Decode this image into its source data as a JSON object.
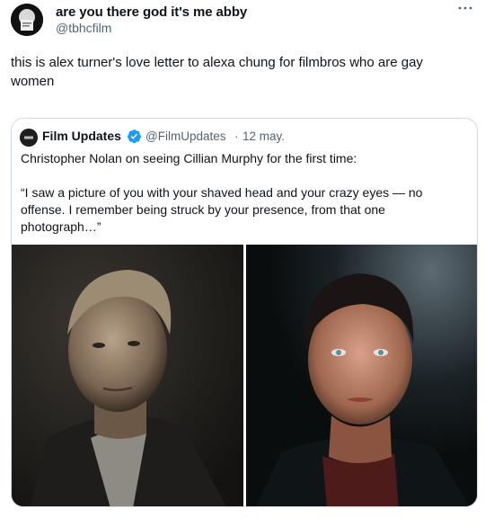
{
  "author": {
    "name": "are you there god it's me abby",
    "handle": "@tbhcfilm",
    "avatar_icon": "profile-photo"
  },
  "more_icon": "more-horizontal-icon",
  "tweet_text": "this is alex turner's love letter to alexa chung for filmbros who are gay women",
  "quoted": {
    "name": "Film Updates",
    "verified_icon": "verified-badge-icon",
    "handle": "@FilmUpdates",
    "separator": "·",
    "date": "12 may.",
    "line1": "Christopher Nolan on seeing Cillian Murphy for the first time:",
    "quote": "“I saw a picture of you with your shaved head and your crazy eyes — no offense. I remember being struck by your presence, from that one photograph…”",
    "media": [
      {
        "name": "photo-christopher-nolan"
      },
      {
        "name": "photo-cillian-murphy"
      }
    ]
  },
  "colors": {
    "text": "#0f1419",
    "secondary": "#536471",
    "border": "#cfd9de",
    "verified": "#1d9bf0"
  }
}
